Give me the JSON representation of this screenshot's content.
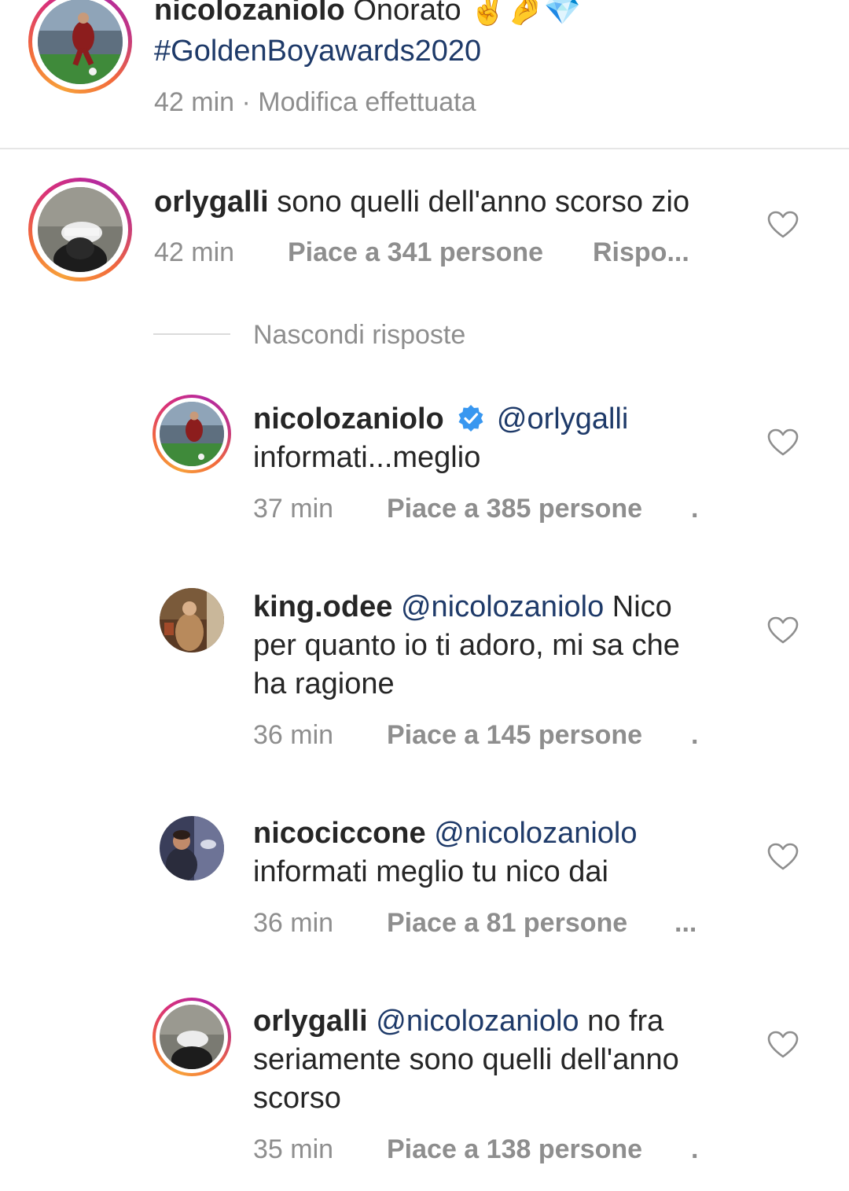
{
  "caption": {
    "username": "nicolozaniolo",
    "text": "Onorato",
    "emojis": "✌️🤌💎",
    "hashtag": "#GoldenBoyawards2020",
    "time": "42 min",
    "separator": " · ",
    "edited": "Modifica effettuata"
  },
  "comment": {
    "username": "orlygalli",
    "text": "sono quelli dell'anno scorso zio",
    "time": "42 min",
    "likes": "Piace a 341 persone",
    "reply": "Rispo...",
    "hide_replies": "Nascondi risposte"
  },
  "replies": [
    {
      "username": "nicolozaniolo",
      "verified": true,
      "mention": "@orlygalli",
      "line1_rest": "",
      "line2": "informati...meglio",
      "line3": "",
      "time": "37 min",
      "likes": "Piace a 385 persone",
      "more": "."
    },
    {
      "username": "king.odee",
      "mention": "@nicolozaniolo",
      "line1_rest": " Nico",
      "line2": "per quanto io ti adoro, mi sa che",
      "line3": "ha ragione",
      "time": "36 min",
      "likes": "Piace a 145 persone",
      "more": "."
    },
    {
      "username": "nicociccone",
      "mention": "@nicolozaniolo",
      "line1_rest": "",
      "line2": "informati meglio tu nico dai",
      "line3": "",
      "time": "36 min",
      "likes": "Piace a 81 persone",
      "more": "..."
    },
    {
      "username": "orlygalli",
      "mention": "@nicolozaniolo",
      "line1_rest": " no fra",
      "line2": "seriamente sono quelli dell'anno",
      "line3": "scorso",
      "time": "35 min",
      "likes": "Piace a 138 persone",
      "more": "."
    }
  ],
  "colors": {
    "text": "#262626",
    "meta": "#8e8e8e",
    "mention": "#1e3a69",
    "verified": "#3897f0",
    "heart_stroke": "#8e8e8e"
  },
  "icons": {
    "heart": "heart-outline-icon",
    "verified": "verified-badge-icon"
  }
}
